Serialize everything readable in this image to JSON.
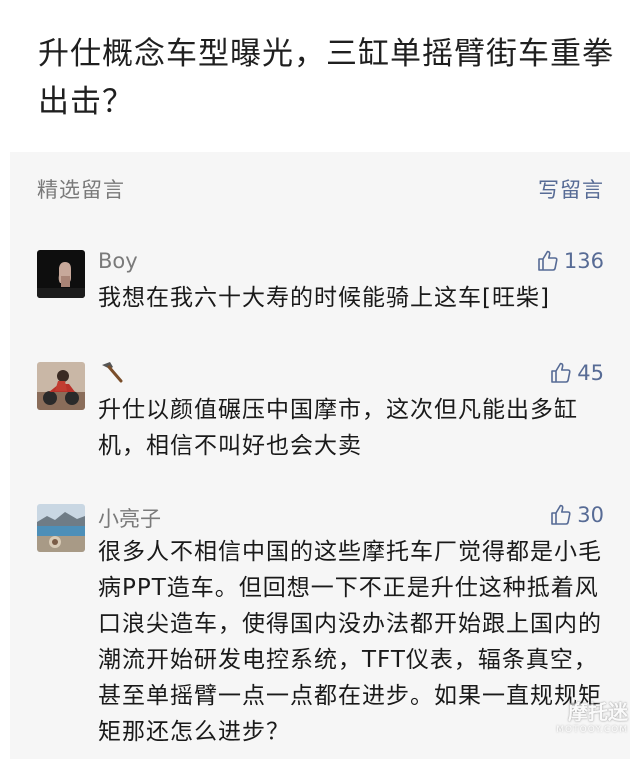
{
  "article": {
    "title": "升仕概念车型曝光，三缸单摇臂街车重拳出击？"
  },
  "comments_section": {
    "title": "精选留言",
    "write_label": "写留言",
    "accent_color": "#576b95"
  },
  "comments": [
    {
      "nickname": "Boy",
      "likes": "136",
      "text": "我想在我六十大寿的时候能骑上这车[旺柴]",
      "avatar": "dark-figure-avatar"
    },
    {
      "nickname": "",
      "nickname_icon": "hammer-icon",
      "likes": "45",
      "text": "升仕以颜值碾压中国摩市，这次但凡能出多缸机，相信不叫好也会大卖",
      "avatar": "motorcycle-rider-avatar"
    },
    {
      "nickname": "小亮子",
      "likes": "30",
      "text": "很多人不相信中国的这些摩托车厂觉得都是小毛病PPT造车。但回想一下不正是升仕这种抵着风口浪尖造车，使得国内没办法都开始跟上国内的潮流开始研发电控系统，TFT仪表，辐条真空，甚至单摇臂一点一点都在进步。如果一直规规矩矩那还怎么进步？",
      "avatar": "lake-landscape-avatar"
    }
  ],
  "watermark": {
    "main": "摩托迷",
    "sub": "MOTOOY.COM"
  }
}
